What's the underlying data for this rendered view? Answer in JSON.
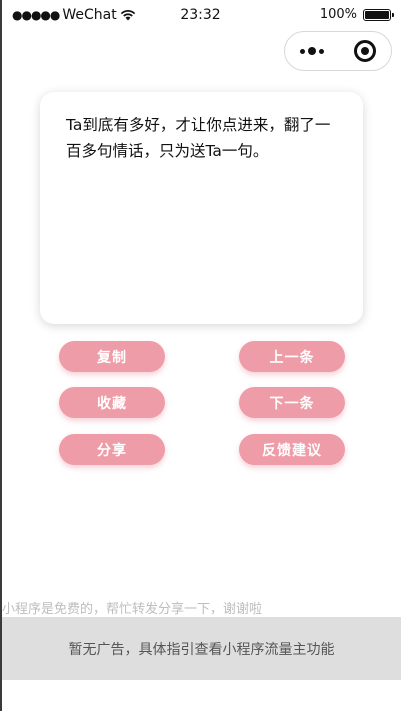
{
  "status_bar": {
    "signal": "●●●●●",
    "carrier": "WeChat",
    "time": "23:32",
    "battery": "100%"
  },
  "capsule": {
    "menu_icon": "more-dots-icon",
    "close_icon": "close-circle-icon"
  },
  "quote": {
    "text": "Ta到底有多好，才让你点进来，翻了一百多句情话，只为送Ta一句。"
  },
  "actions": {
    "copy": "复制",
    "previous": "上一条",
    "favorite": "收藏",
    "next": "下一条",
    "share": "分享",
    "feedback": "反馈建议"
  },
  "footer": {
    "share_hint": "小程序是免费的，帮忙转发分享一下，谢谢啦",
    "ad_text": "暂无广告，具体指引查看小程序流量主功能"
  },
  "colors": {
    "accent": "#ee9ca8",
    "ad_background": "#dedede"
  }
}
